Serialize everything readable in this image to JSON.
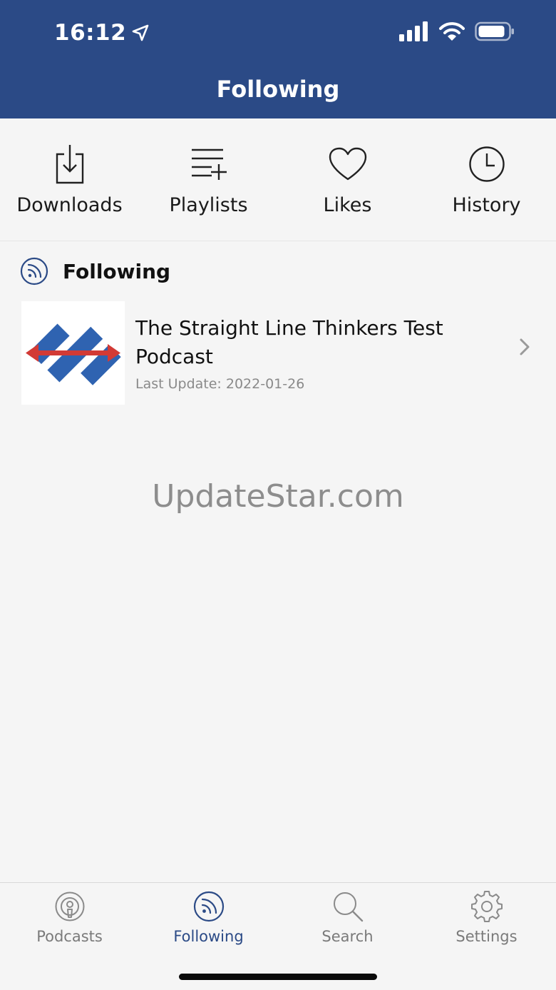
{
  "status_bar": {
    "time": "16:12"
  },
  "header": {
    "title": "Following"
  },
  "quick_actions": [
    {
      "label": "Downloads",
      "icon": "download-icon"
    },
    {
      "label": "Playlists",
      "icon": "playlist-add-icon"
    },
    {
      "label": "Likes",
      "icon": "heart-icon"
    },
    {
      "label": "History",
      "icon": "clock-icon"
    }
  ],
  "section": {
    "title": "Following",
    "icon": "rss-icon"
  },
  "podcasts": [
    {
      "title": "The Straight Line Thinkers Test Podcast",
      "last_update": "Last Update: 2022-01-26"
    }
  ],
  "watermark": "UpdateStar.com",
  "tabs": [
    {
      "label": "Podcasts",
      "icon": "podcast-icon",
      "active": false
    },
    {
      "label": "Following",
      "icon": "rss-icon",
      "active": true
    },
    {
      "label": "Search",
      "icon": "search-icon",
      "active": false
    },
    {
      "label": "Settings",
      "icon": "gear-icon",
      "active": false
    }
  ],
  "colors": {
    "header_bg": "#2b4a86",
    "accent": "#2b4a86",
    "background": "#f5f5f5",
    "logo_blue": "#2f63b1",
    "logo_red": "#d23a35"
  }
}
